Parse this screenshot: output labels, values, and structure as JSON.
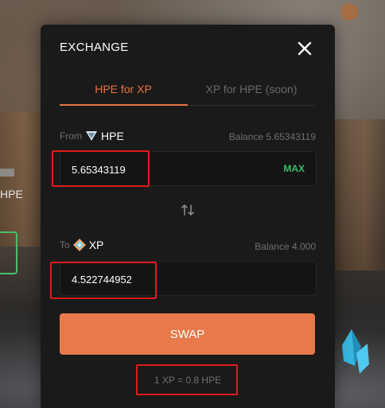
{
  "background": {
    "side_text": "HPE"
  },
  "modal": {
    "title": "EXCHANGE",
    "close_icon": "close-icon",
    "tabs": [
      {
        "label": "HPE for XP",
        "active": true
      },
      {
        "label": "XP for HPE (soon)",
        "active": false
      }
    ],
    "from": {
      "label": "From",
      "token": "HPE",
      "token_icon": "hpe-token-icon",
      "balance": "Balance 5.65343119",
      "value": "5.65343119",
      "max_label": "MAX"
    },
    "swap_direction_icon": "swap-vertical-icon",
    "to": {
      "label": "To",
      "token": "XP",
      "token_icon": "xp-token-icon",
      "balance": "Balance 4.000",
      "value": "4.522744952"
    },
    "swap_label": "SWAP",
    "rate": "1 XP = 0.8 HPE"
  },
  "colors": {
    "accent": "#e9743f",
    "swap_button": "#e8794a",
    "max_green": "#3fb86a",
    "highlight_red": "#e01b1b",
    "panel": "#1a1a1a"
  }
}
